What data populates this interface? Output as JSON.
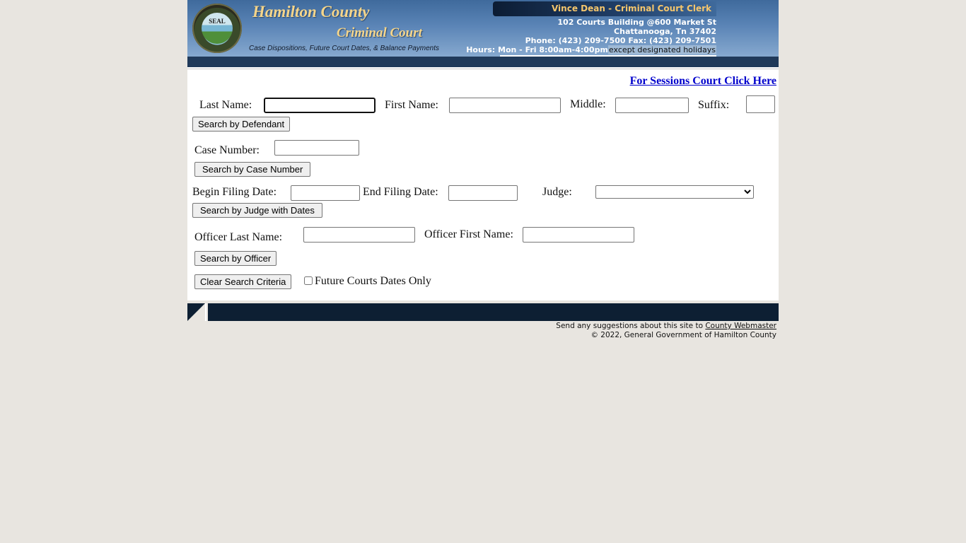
{
  "header": {
    "title_line1": "Hamilton County",
    "title_line2": "Criminal Court",
    "subtitle": "Case Dispositions, Future Court Dates, & Balance Payments",
    "seal_text": "SEAL",
    "clerk": "Vince Dean - Criminal Court Clerk",
    "address_line1": "102 Courts Building @600 Market St",
    "address_line2": "Chattanooga, Tn 37402",
    "phone_fax": "Phone: (423) 209-7500 Fax: (423) 209-7501",
    "hours": "Hours: Mon - Fri 8:00am-4:00pm",
    "hours_note": "except designated holidays"
  },
  "links": {
    "sessions": "For Sessions Court Click Here"
  },
  "defendant_search": {
    "last_name_label": "Last Name:",
    "last_name_value": "",
    "first_name_label": "First Name:",
    "first_name_value": "",
    "middle_label": "Middle:",
    "middle_value": "",
    "suffix_label": "Suffix:",
    "suffix_value": "",
    "button": "Search by Defendant"
  },
  "case_search": {
    "case_number_label": "Case Number:",
    "case_number_value": "",
    "button": "Search by Case Number"
  },
  "judge_search": {
    "begin_date_label": "Begin Filing Date:",
    "begin_date_value": "",
    "end_date_label": "End Filing Date:",
    "end_date_value": "",
    "judge_label": "Judge:",
    "judge_selected": "",
    "button": "Search by Judge with Dates"
  },
  "officer_search": {
    "last_name_label": "Officer Last Name:",
    "last_name_value": "",
    "first_name_label": "Officer First Name:",
    "first_name_value": "",
    "button": "Search by Officer"
  },
  "options": {
    "clear_button": "Clear Search Criteria",
    "future_only_label": "Future Courts Dates Only",
    "future_only_checked": false
  },
  "footer": {
    "suggestions_text": "Send any suggestions about this site to",
    "webmaster_link": "County Webmaster",
    "copyright": "© 2022, General Government of Hamilton County"
  }
}
